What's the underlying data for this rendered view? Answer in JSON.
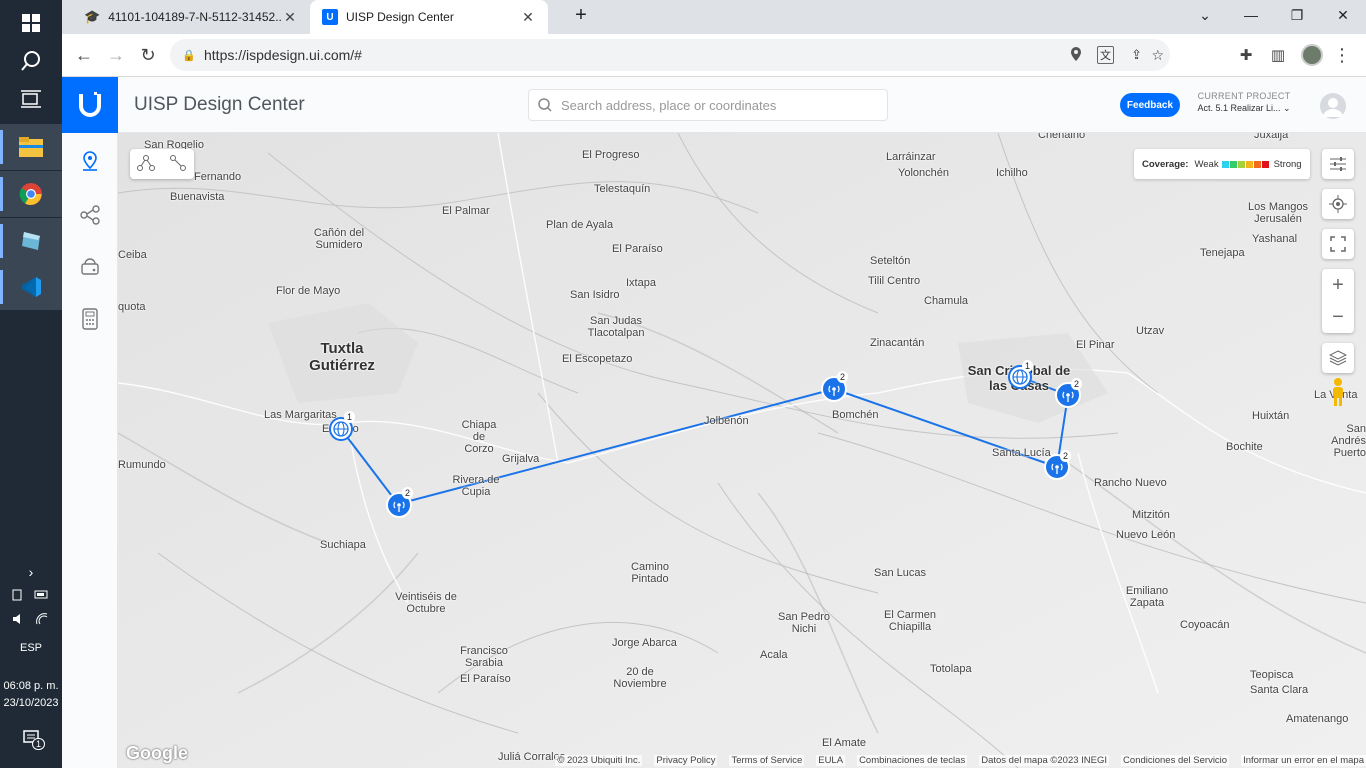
{
  "taskbar": {
    "lang": "ESP",
    "time": "06:08 p. m.",
    "date": "23/10/2023",
    "notif_count": "1"
  },
  "browser": {
    "tabs": [
      {
        "title": "41101-104189-7-N-5112-31452..."
      },
      {
        "title": "UISP Design Center"
      }
    ],
    "url": "https://ispdesign.ui.com/#"
  },
  "app": {
    "title": "UISP Design Center",
    "search_placeholder": "Search address, place or coordinates",
    "feedback_label": "Feedback",
    "project_label": "CURRENT PROJECT",
    "project_name": "Act. 5.1 Realizar Li...",
    "coverage": {
      "label": "Coverage:",
      "weak": "Weak",
      "strong": "Strong",
      "colors": [
        "#2ad2f0",
        "#33cc66",
        "#a6d13a",
        "#f5b41a",
        "#f26a1b",
        "#e0121b"
      ]
    }
  },
  "map": {
    "places": [
      {
        "name": "San Rogelio",
        "cls": ""
      },
      {
        "name": "Fernando",
        "cls": ""
      },
      {
        "name": "Buenavista",
        "cls": ""
      },
      {
        "name": "Cañón del Sumidero",
        "cls": ""
      },
      {
        "name": "Ceiba",
        "cls": ""
      },
      {
        "name": "Flor de Mayo",
        "cls": ""
      },
      {
        "name": "quota",
        "cls": ""
      },
      {
        "name": "Tuxtla Gutiérrez",
        "cls": "city"
      },
      {
        "name": "Las Margaritas",
        "cls": ""
      },
      {
        "name": "El Jobo",
        "cls": ""
      },
      {
        "name": "Chiapa de Corzo",
        "cls": ""
      },
      {
        "name": "Grijalva",
        "cls": ""
      },
      {
        "name": "Rivera de Cupia",
        "cls": ""
      },
      {
        "name": "Suchiapa",
        "cls": ""
      },
      {
        "name": "Veintiséis de Octubre",
        "cls": ""
      },
      {
        "name": "Francisco Sarabia",
        "cls": ""
      },
      {
        "name": "El Paraíso",
        "cls": ""
      },
      {
        "name": "Jorge Abarca",
        "cls": ""
      },
      {
        "name": "20 de Noviembre",
        "cls": ""
      },
      {
        "name": "Camino Pintado",
        "cls": ""
      },
      {
        "name": "El Progreso",
        "cls": ""
      },
      {
        "name": "El Palmar",
        "cls": ""
      },
      {
        "name": "Telestaquín",
        "cls": ""
      },
      {
        "name": "Plan de Ayala",
        "cls": ""
      },
      {
        "name": "El Paraíso",
        "cls": ""
      },
      {
        "name": "Ixtapa",
        "cls": ""
      },
      {
        "name": "San Isidro",
        "cls": ""
      },
      {
        "name": "San Judas Tlacotalpan",
        "cls": ""
      },
      {
        "name": "El Escopetazo",
        "cls": ""
      },
      {
        "name": "Acala",
        "cls": ""
      },
      {
        "name": "San Pedro Nichi",
        "cls": ""
      },
      {
        "name": "San Lucas",
        "cls": ""
      },
      {
        "name": "El Carmen Chiapilla",
        "cls": ""
      },
      {
        "name": "Totolapa",
        "cls": ""
      },
      {
        "name": "El Amate",
        "cls": ""
      },
      {
        "name": "Juliá Corrales",
        "cls": ""
      },
      {
        "name": "Larráinzar",
        "cls": ""
      },
      {
        "name": "Yolonchén",
        "cls": ""
      },
      {
        "name": "Ichilho",
        "cls": ""
      },
      {
        "name": "Chenalhó",
        "cls": ""
      },
      {
        "name": "Seteltón",
        "cls": ""
      },
      {
        "name": "Tilil Centro",
        "cls": ""
      },
      {
        "name": "Chamula",
        "cls": ""
      },
      {
        "name": "Zinacantán",
        "cls": ""
      },
      {
        "name": "Bomchén",
        "cls": ""
      },
      {
        "name": "Jolbenón",
        "cls": ""
      },
      {
        "name": "Utzav",
        "cls": ""
      },
      {
        "name": "El Pinar",
        "cls": ""
      },
      {
        "name": "San Cristóbal de las Casas",
        "cls": "city"
      },
      {
        "name": "Santa Lucía",
        "cls": ""
      },
      {
        "name": "Rancho Nuevo",
        "cls": ""
      },
      {
        "name": "Mitzitón",
        "cls": ""
      },
      {
        "name": "Nuevo León",
        "cls": ""
      },
      {
        "name": "Emiliano Zapata",
        "cls": ""
      },
      {
        "name": "Coyoacán",
        "cls": ""
      },
      {
        "name": "Teopisca",
        "cls": ""
      },
      {
        "name": "Santa Clara",
        "cls": ""
      },
      {
        "name": "Amatenango",
        "cls": ""
      },
      {
        "name": "Bochite",
        "cls": ""
      },
      {
        "name": "Huixtán",
        "cls": ""
      },
      {
        "name": "San Andrés Puerto",
        "cls": ""
      },
      {
        "name": "La Venta",
        "cls": ""
      },
      {
        "name": "Tenejapa",
        "cls": ""
      },
      {
        "name": "Yashanal",
        "cls": ""
      },
      {
        "name": "Los Mangos Jerusalén",
        "cls": ""
      },
      {
        "name": "Juxaija",
        "cls": ""
      },
      {
        "name": "Rumundo",
        "cls": ""
      }
    ],
    "devices": [
      {
        "id": "site-1",
        "type": "site",
        "count": "1"
      },
      {
        "id": "ap-1",
        "type": "ap",
        "count": "2"
      },
      {
        "id": "ap-2",
        "type": "ap",
        "count": "2"
      },
      {
        "id": "site-2",
        "type": "site",
        "count": "1"
      },
      {
        "id": "ap-3",
        "type": "ap",
        "count": "2"
      },
      {
        "id": "ap-4",
        "type": "ap",
        "count": "2"
      }
    ]
  },
  "footer": {
    "google": "Google",
    "items": [
      "© 2023 Ubiquiti Inc.",
      "Privacy Policy",
      "Terms of Service",
      "EULA",
      "Combinaciones de teclas",
      "Datos del mapa ©2023 INEGI",
      "Condiciones del Servicio",
      "Informar un error en el mapa"
    ]
  }
}
